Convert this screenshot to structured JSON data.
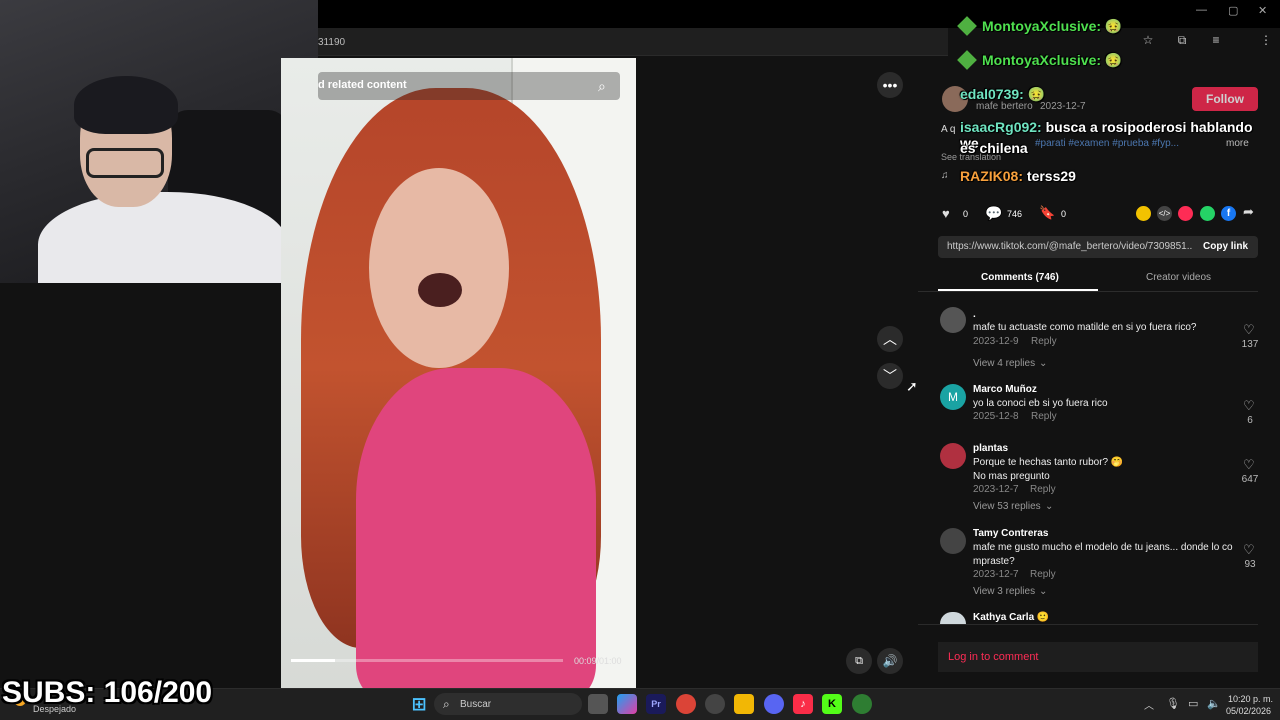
{
  "browser": {
    "address_fragment": "31190",
    "minimize": "—",
    "restore": "▢",
    "close": "✕"
  },
  "video": {
    "search_label": "d related content",
    "time_label": "00:09/01:00",
    "progress": 0.16
  },
  "post": {
    "author_handle": "mafe bertero",
    "date": "2023-12-7",
    "follow_label": "Follow",
    "caption_start": "A q",
    "hashtags": "#parati #examen #prueba #fyp...",
    "more_label": "more",
    "see_translation": "See translation",
    "likes": "0",
    "comments": "746",
    "saves": "0",
    "link": "https://www.tiktok.com/@mafe_bertero/video/7309851...",
    "copy_link_label": "Copy link"
  },
  "tabs": [
    {
      "label": "Comments (746)",
      "active": true
    },
    {
      "label": "Creator videos",
      "active": false
    }
  ],
  "comments": [
    {
      "name": ".",
      "text": "mafe tu actuaste como matilde en si yo fuera rico?",
      "date": "2023-12-9",
      "reply": "Reply",
      "likes": "137",
      "replies": "View 4 replies",
      "avatar_color": "#555555",
      "avatar_letter": ""
    },
    {
      "name": "Marco Muñoz",
      "text": "yo la conoci eb si yo fuera rico",
      "date": "2025-12-8",
      "reply": "Reply",
      "likes": "6",
      "replies": "",
      "avatar_color": "#1aa3a3",
      "avatar_letter": "M"
    },
    {
      "name": "plantas",
      "text": "Porque te hechas tanto rubor? 🤭",
      "text2": "No mas pregunto",
      "date": "2023-12-7",
      "reply": "Reply",
      "likes": "647",
      "replies": "View 53 replies",
      "avatar_color": "#b03040",
      "avatar_letter": ""
    },
    {
      "name": "Tamy Contreras",
      "text": "mafe me gusto mucho el modelo de tu jeans... donde lo co",
      "text2": "mpraste?",
      "date": "2023-12-7",
      "reply": "Reply",
      "likes": "93",
      "replies": "View 3 replies",
      "avatar_color": "#444444",
      "avatar_letter": ""
    },
    {
      "name": "Kathya Carla 🙂",
      "avatar_color": "#cfd8dc",
      "avatar_letter": ""
    }
  ],
  "login_label": "Log in to comment",
  "chat": [
    {
      "user": "MontoyaXclusive:",
      "color": "#4fe04f",
      "message": "🤢"
    },
    {
      "user": "MontoyaXclusive:",
      "color": "#4fe04f",
      "message": "🤢"
    },
    {
      "user": "edal0739:",
      "color": "#6fe3c0",
      "message": "🤢"
    },
    {
      "user": "isaacRg092:",
      "color": "#6fe3c0",
      "message": "busca a rosipoderosi hablando we",
      "message2": "es chilena"
    },
    {
      "user": "RAZIK08:",
      "color": "#f7a03c",
      "message": "terss29"
    }
  ],
  "overlay": {
    "subs": "SUBS: 106/200",
    "weather": "Despejado"
  },
  "taskbar": {
    "search_label": "Buscar",
    "time": "10:20 p. m.",
    "date": "05/02/2026"
  },
  "colors": {
    "accent": "#fe2c55",
    "panel_bg": "#121212"
  }
}
